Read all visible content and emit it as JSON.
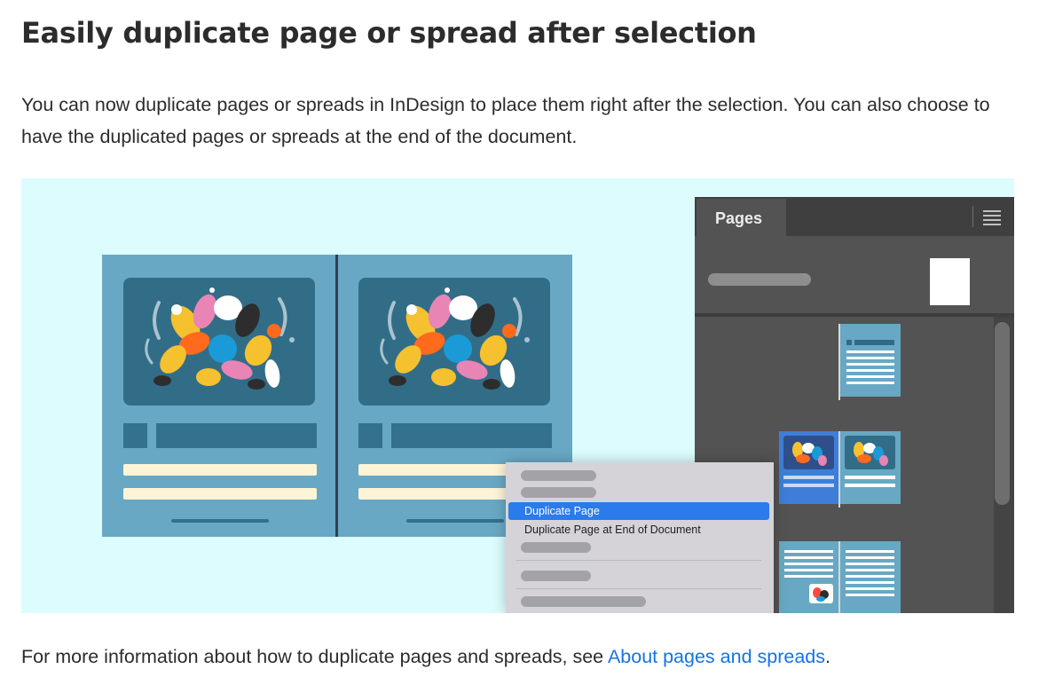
{
  "heading": "Easily duplicate page or spread after selection",
  "intro": "You can now duplicate pages or spreads in InDesign to place them right after the selection. You can also choose to have the duplicated pages or spreads at the end of the document.",
  "illustration": {
    "panel": {
      "tab_label": "Pages",
      "menu_icon": "hamburger-icon"
    },
    "context_menu": {
      "items": [
        "Duplicate Page",
        "Duplicate Page at End of Document"
      ],
      "highlighted": "Duplicate Page"
    }
  },
  "footer": {
    "text_before": "For more information about how to duplicate pages and spreads, see ",
    "link_text": "About pages and spreads",
    "text_after": "."
  },
  "colors": {
    "link": "#1473e6",
    "illustration_bg": "#dcfcfd",
    "page_blue": "#68a8c4",
    "menu_highlight": "#2b7bea",
    "panel_bg": "#535353"
  }
}
